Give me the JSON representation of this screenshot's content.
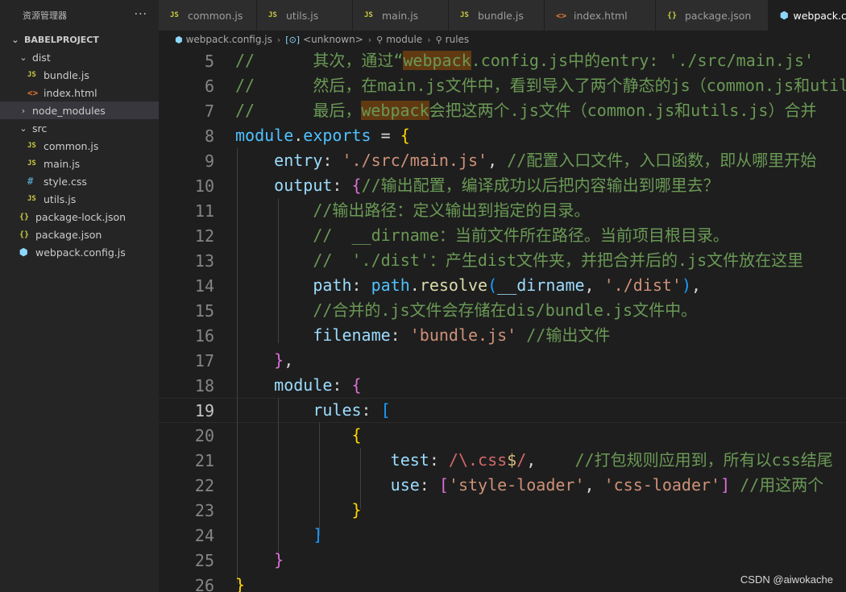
{
  "explorer": {
    "title": "资源管理器",
    "more": "···",
    "root": "BABELPROJECT",
    "items": [
      {
        "label": "dist",
        "chevron": "⌄",
        "icon": "",
        "indent": 0
      },
      {
        "label": "bundle.js",
        "chevron": "",
        "icon": "JS",
        "indent": 1
      },
      {
        "label": "index.html",
        "chevron": "",
        "icon": "<>",
        "indent": 1
      },
      {
        "label": "node_modules",
        "chevron": "›",
        "icon": "",
        "indent": 0
      },
      {
        "label": "src",
        "chevron": "⌄",
        "icon": "",
        "indent": 0
      },
      {
        "label": "common.js",
        "chevron": "",
        "icon": "JS",
        "indent": 1
      },
      {
        "label": "main.js",
        "chevron": "",
        "icon": "JS",
        "indent": 1
      },
      {
        "label": "style.css",
        "chevron": "",
        "icon": "#",
        "indent": 1
      },
      {
        "label": "utils.js",
        "chevron": "",
        "icon": "JS",
        "indent": 1
      },
      {
        "label": "package-lock.json",
        "chevron": "",
        "icon": "{}",
        "indent": 0
      },
      {
        "label": "package.json",
        "chevron": "",
        "icon": "{}",
        "indent": 0
      },
      {
        "label": "webpack.config.js",
        "chevron": "",
        "icon": "⬢",
        "indent": 0
      }
    ]
  },
  "tabs": [
    {
      "label": "common.js",
      "icon": "JS"
    },
    {
      "label": "utils.js",
      "icon": "JS"
    },
    {
      "label": "main.js",
      "icon": "JS"
    },
    {
      "label": "bundle.js",
      "icon": "JS"
    },
    {
      "label": "index.html",
      "icon": "<>"
    },
    {
      "label": "package.json",
      "icon": "{}"
    },
    {
      "label": "webpack.config.js",
      "icon": "⬢"
    }
  ],
  "breadcrumb": [
    "webpack.config.js",
    "<unknown>",
    "module",
    "rules"
  ],
  "editor": {
    "current_line": 19,
    "line_numbers": [
      "5",
      "6",
      "7",
      "8",
      "9",
      "10",
      "11",
      "12",
      "13",
      "14",
      "15",
      "16",
      "17",
      "18",
      "19",
      "20",
      "21",
      "22",
      "23",
      "24",
      "25",
      "26"
    ]
  },
  "watermark": "CSDN @aiwokache",
  "colors": {
    "background": "#1e1e1e",
    "sidebar": "#252526",
    "comment": "#6a9955",
    "string": "#ce9178",
    "keyword": "#569cd6"
  }
}
